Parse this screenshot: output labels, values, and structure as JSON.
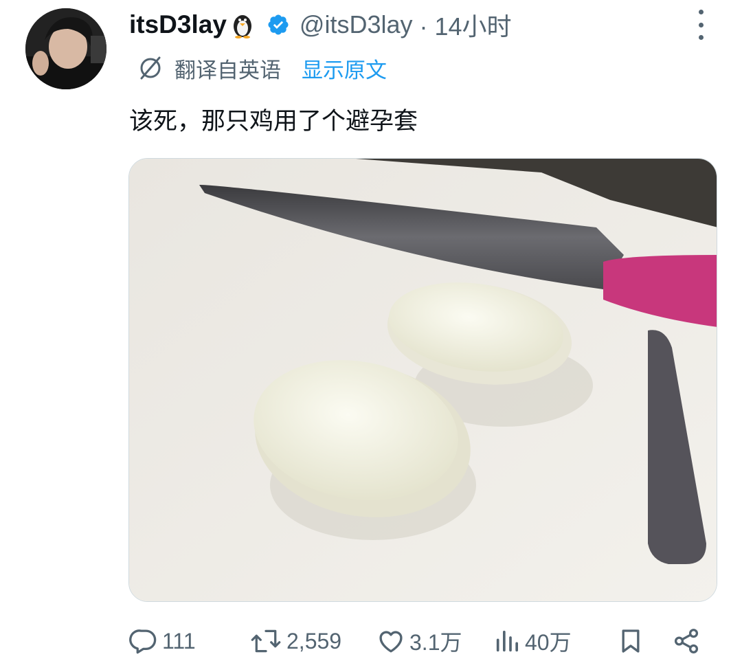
{
  "author": {
    "display_name": "itsD3lay",
    "name_emoji_icon": "penguin-icon",
    "verified_icon": "verified-badge-icon",
    "handle": "@itsD3lay",
    "timestamp": "· 14小时"
  },
  "translation": {
    "label": "翻译自英语",
    "show_original": "显示原文"
  },
  "tweet": {
    "text": "该死，那只鸡用了个避孕套"
  },
  "media": {
    "description_icon": "photo-egg-halves-on-cutting-board"
  },
  "actions": {
    "reply_count": "111",
    "retweet_count": "2,559",
    "like_count": "3.1万",
    "views_count": "40万"
  },
  "colors": {
    "accent": "#1d9bf0",
    "secondary_text": "#536471",
    "primary_text": "#0f1419"
  }
}
